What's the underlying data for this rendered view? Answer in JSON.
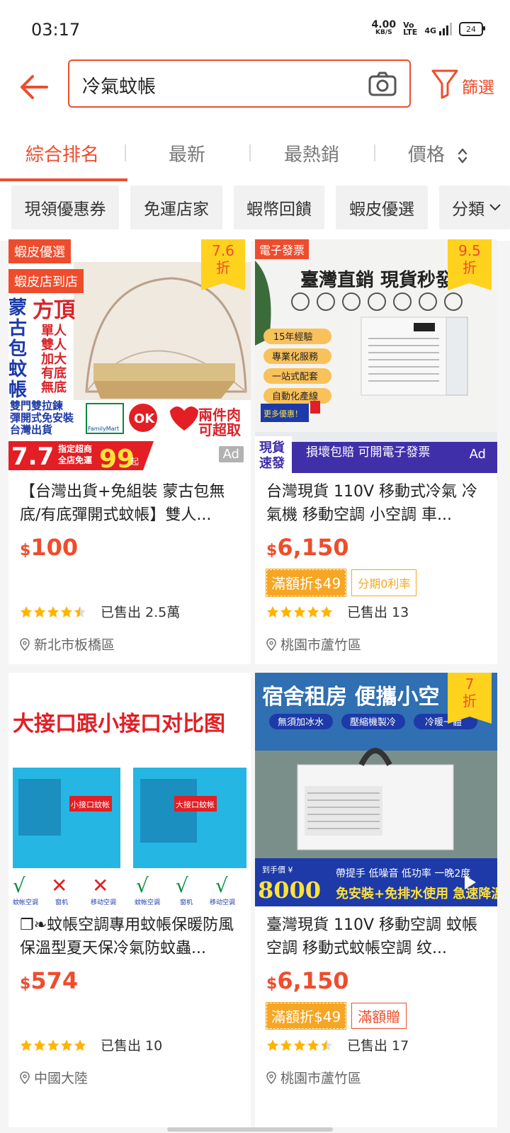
{
  "status_bar": {
    "time": "03:17",
    "speed_value": "4.00",
    "speed_unit": "KB/S",
    "volte": "Vo\nLTE",
    "network": "4G",
    "battery": "24"
  },
  "search": {
    "query": "冷氣蚊帳",
    "filter_label": "篩選"
  },
  "sort_tabs": [
    {
      "label": "綜合排名",
      "active": true
    },
    {
      "label": "最新",
      "active": false
    },
    {
      "label": "最熱銷",
      "active": false
    },
    {
      "label": "價格",
      "active": false
    }
  ],
  "filter_chips": [
    "現領優惠券",
    "免運店家",
    "蝦幣回饋",
    "蝦皮優選",
    "分類"
  ],
  "products": [
    {
      "title": "【台灣出貨+免組裝 蒙古包無底/有底彈開式蚊帳】雙人...",
      "currency": "$",
      "price": "100",
      "discount_value": "7.6",
      "discount_unit": "折",
      "badge_top": "蝦皮優選",
      "badge_second": "蝦皮店到店",
      "ad": "Ad",
      "rating": 4.5,
      "sold": "已售出 2.5萬",
      "location": "新北市板橋區",
      "img_texts": {
        "big": "7.7",
        "mid": "指定超商\n全店免運",
        "num": "99",
        "unit": "起",
        "side1": "蒙古包蚊帳",
        "side2": "方頂",
        "list": "單人\n雙人\n加大\n有底\n無底",
        "bottom": "雙門雙拉鍊\n彈開式免安裝\n台灣出貨",
        "promo": "兩件肉\n可超取",
        "fm": "FamilyMart",
        "ok": "OK",
        "hilife": "Hi-Life"
      }
    },
    {
      "title": "台灣現貨 110V 移動式冷氣 冷氣機 移動空調 小空調 車...",
      "currency": "$",
      "price": "6,150",
      "discount_value": "9.5",
      "discount_unit": "折",
      "badge_top": "電子發票",
      "ad": "Ad",
      "tag_fill": "滿額折$49",
      "tag_outline": "分期0利率",
      "rating": 5,
      "sold": "已售出 13",
      "location": "桃園市蘆竹區",
      "img_texts": {
        "headline": "臺灣直銷 現貨秒發",
        "f1": "15年經驗",
        "f2": "專業化服務",
        "f3": "一站式配套",
        "f4": "自動化產線",
        "bottom_left": "現貨\n速發",
        "bottom_mid": "損壞包賠  可開電子發票"
      }
    },
    {
      "title": "❒❧蚊帳空調專用蚊帳保暖防風保溫型夏天保冷氣防蚊蟲...",
      "currency": "$",
      "price": "574",
      "rating": 5,
      "sold": "已售出 10",
      "location": "中國大陸",
      "img_texts": {
        "headline": "大接口跟小接口对比图",
        "l1": "小接口蚊帐",
        "l2": "大接口蚊帐",
        "c1": "蚊帐空调",
        "c2": "窗机",
        "c3": "移动空调"
      }
    },
    {
      "title": "臺灣現貨 110V 移動空調 蚊帳空調 移動式蚊帳空調 纹...",
      "currency": "$",
      "price": "6,150",
      "discount_value": "7",
      "discount_unit": "折",
      "tag_fill": "滿額折$49",
      "tag_outline": "滿額贈",
      "rating": 4.5,
      "sold": "已售出 17",
      "location": "桃園市蘆竹區",
      "img_texts": {
        "headline": "宿舍租房 便攜小空",
        "sub1": "無須加冰水",
        "sub2": "壓縮機製冷",
        "sub3": "冷暖一體",
        "price_big": "8000",
        "bottom": "免安裝+免排水使用 急速降溫",
        "row": "帶提手  低噪音  低功率  一晚2度"
      }
    }
  ]
}
